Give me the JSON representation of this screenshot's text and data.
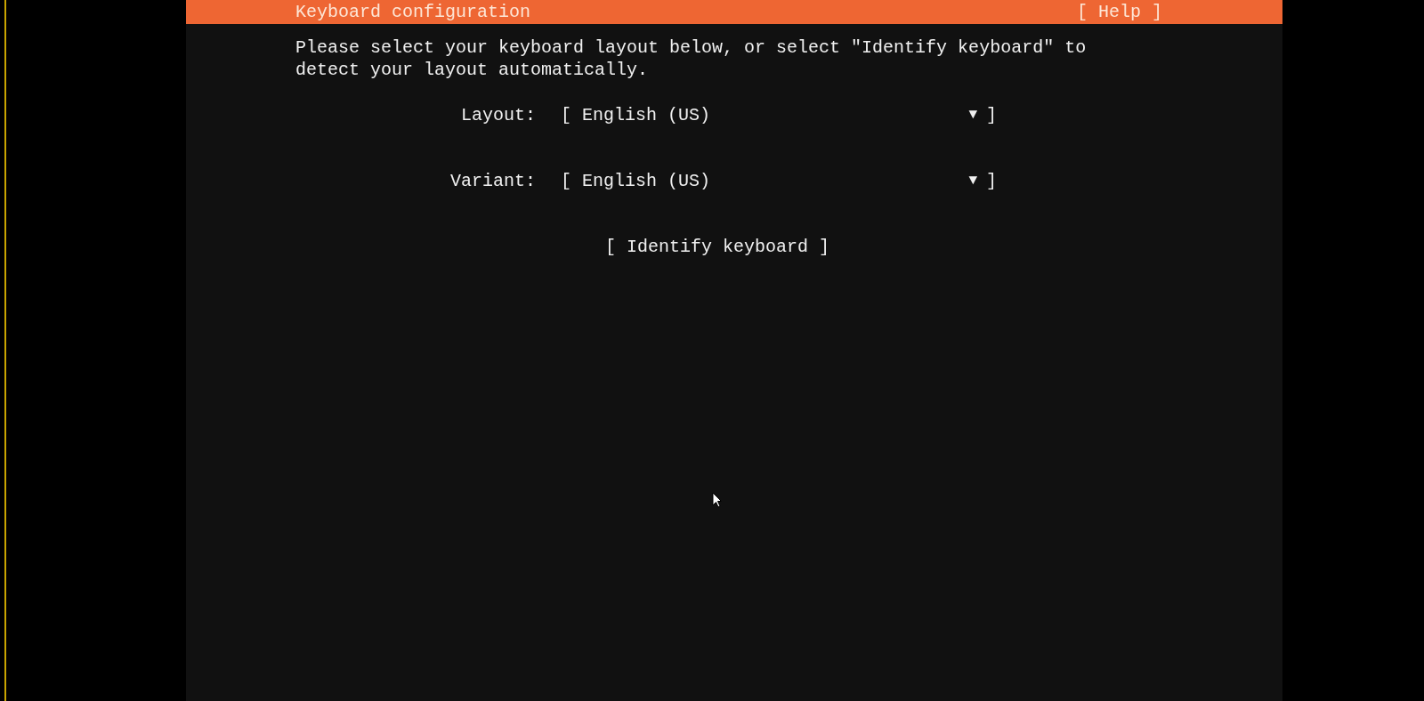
{
  "header": {
    "title": "Keyboard configuration",
    "help": "[ Help ]"
  },
  "intro": "Please select your keyboard layout below, or select \"Identify keyboard\" to detect your layout automatically.",
  "fields": [
    {
      "label": "Layout:",
      "open": "[",
      "value": "English (US)",
      "arrow": "▼",
      "close": "]"
    },
    {
      "label": "Variant:",
      "open": "[",
      "value": "English (US)",
      "arrow": "▼",
      "close": "]"
    }
  ],
  "identify_button": "[ Identify keyboard ]"
}
